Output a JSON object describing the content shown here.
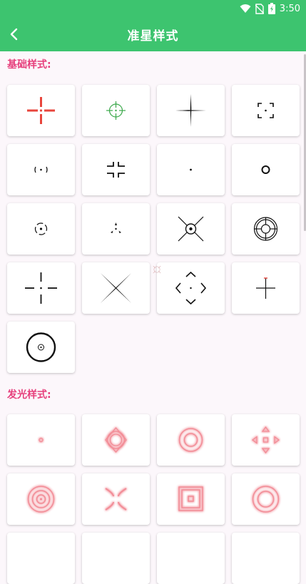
{
  "status_bar": {
    "time": "3:50",
    "icons": [
      "wifi-icon",
      "no-sim-icon",
      "battery-charging-icon"
    ]
  },
  "app_bar": {
    "title": "准星样式",
    "back_icon": "back-arrow-icon"
  },
  "sections": [
    {
      "title": "基础样式:",
      "items": [
        "red-cross-crosshair",
        "green-circle-crosshair",
        "thin-cross-crosshair",
        "corner-brackets-crosshair",
        "parentheses-dot-crosshair",
        "square-brackets-crosshair",
        "dot-crosshair",
        "circle-crosshair",
        "dashed-circle-crosshair",
        "tri-dot-crosshair",
        "x-circle-crosshair",
        "double-ring-crosshair",
        "gap-cross-crosshair",
        "x-lines-crosshair",
        "diamond-arrows-crosshair",
        "small-cross-crosshair",
        "thick-ring-crosshair"
      ]
    },
    {
      "title": "发光样式:",
      "items": [
        "glow-bar-crosshair",
        "glow-diamond-crosshair",
        "glow-scope-crosshair",
        "glow-arrows-crosshair",
        "glow-rings-crosshair",
        "glow-x-crosshair",
        "glow-square-crosshair",
        "glow-target-crosshair"
      ]
    }
  ],
  "colors": {
    "accent": "#3dc46f",
    "section_title": "#e63f7c",
    "crosshair_red": "#e8453c",
    "crosshair_green": "#3aa84a",
    "glow": "#f07a86"
  }
}
